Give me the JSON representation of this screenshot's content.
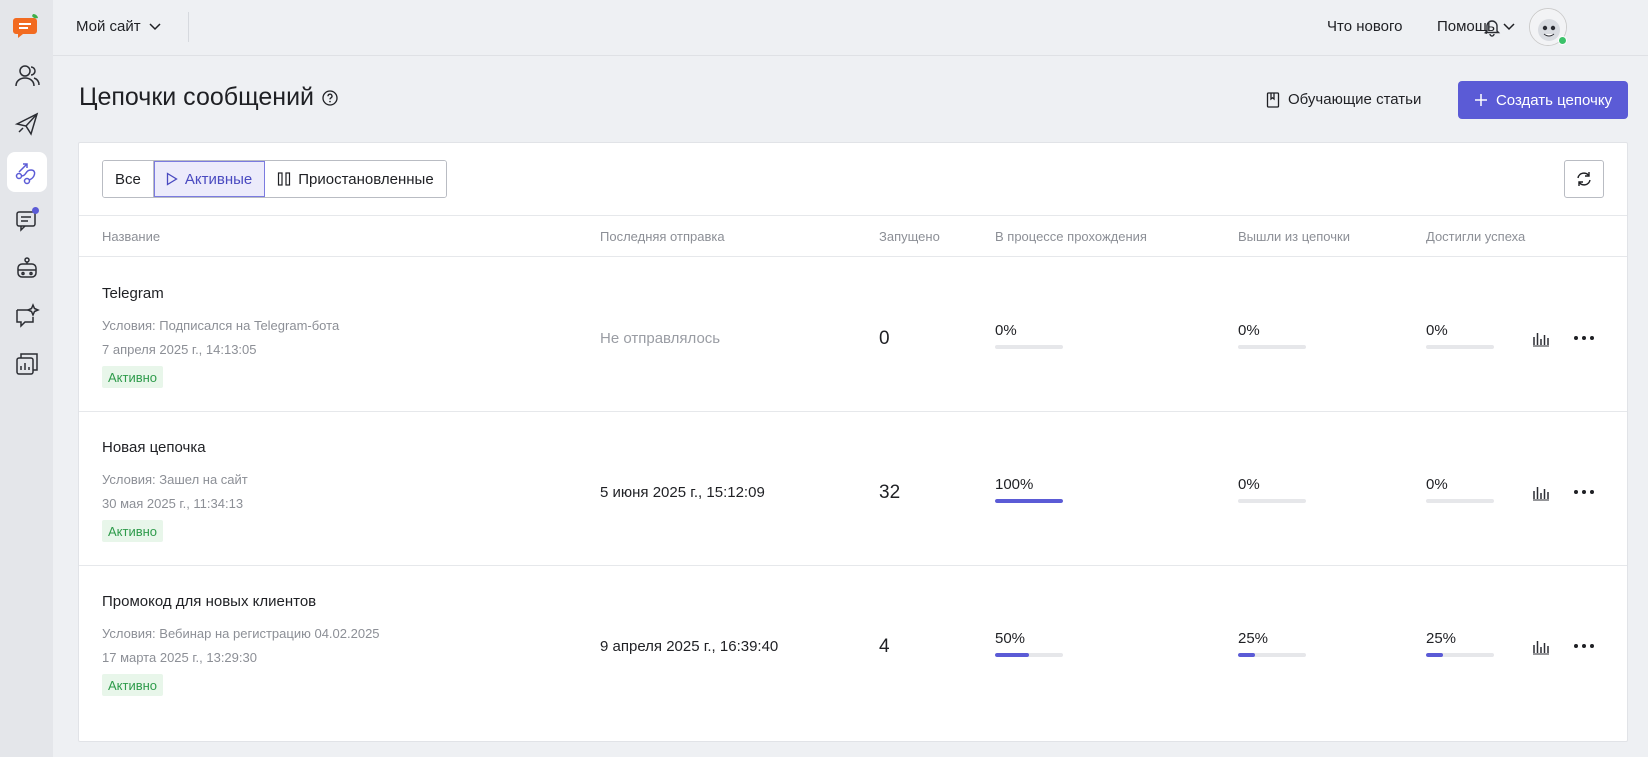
{
  "header": {
    "site_selector": "Мой сайт",
    "whats_new": "Что нового",
    "help": "Помощь"
  },
  "page": {
    "title": "Цепочки сообщений",
    "articles_button": "Обучающие статьи",
    "create_button": "Создать цепочку"
  },
  "filters": [
    {
      "label": "Все",
      "active": false
    },
    {
      "label": "Активные",
      "active": true
    },
    {
      "label": "Приостановленные",
      "active": false
    }
  ],
  "table": {
    "columns": {
      "name": "Название",
      "last_sent": "Последняя отправка",
      "started": "Запущено",
      "in_progress": "В процессе прохождения",
      "exited": "Вышли из цепочки",
      "success": "Достигли успеха"
    },
    "rows": [
      {
        "name": "Telegram",
        "condition": "Условия: Подписался на Telegram-бота",
        "created": "7 апреля 2025 г., 14:13:05",
        "status": "Активно",
        "last_sent": "Не отправлялось",
        "last_sent_muted": true,
        "started": "0",
        "in_progress": "0%",
        "in_progress_value": 0,
        "exited": "0%",
        "exited_value": 0,
        "success": "0%",
        "success_value": 0
      },
      {
        "name": "Новая цепочка",
        "condition": "Условия: Зашел на сайт",
        "created": "30 мая 2025 г., 11:34:13",
        "status": "Активно",
        "last_sent": "5 июня 2025 г., 15:12:09",
        "last_sent_muted": false,
        "started": "32",
        "in_progress": "100%",
        "in_progress_value": 100,
        "exited": "0%",
        "exited_value": 0,
        "success": "0%",
        "success_value": 0
      },
      {
        "name": "Промокод для новых клиентов",
        "condition": "Условия: Вебинар на регистрацию 04.02.2025",
        "created": "17 марта 2025 г., 13:29:30",
        "status": "Активно",
        "last_sent": "9 апреля 2025 г., 16:39:40",
        "last_sent_muted": false,
        "started": "4",
        "in_progress": "50%",
        "in_progress_value": 50,
        "exited": "25%",
        "exited_value": 25,
        "success": "25%",
        "success_value": 25
      }
    ]
  },
  "colors": {
    "accent": "#5b5bd6",
    "badge_text": "#2e9b4b",
    "badge_bg": "#e8f6ea",
    "online": "#3cc26a",
    "logo": "#f26b21"
  },
  "icons": {
    "sidebar": [
      "logo-icon",
      "contacts-icon",
      "campaigns-icon",
      "chains-icon",
      "chats-icon",
      "bots-icon",
      "ai-icon",
      "reports-icon"
    ]
  }
}
